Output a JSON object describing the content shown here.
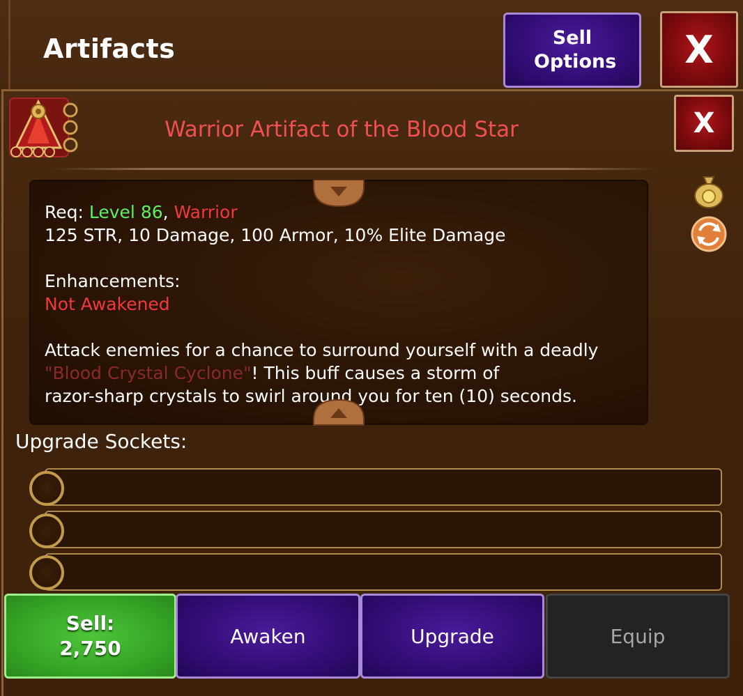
{
  "header": {
    "title": "Artifacts",
    "sell_options_label": "Sell Options",
    "close_label": "X"
  },
  "item": {
    "name": "Warrior Artifact of the Blood Star",
    "name_color": "#f05050",
    "close_label": "X",
    "icon": "blood-star-artifact-icon"
  },
  "side_icons": {
    "gold_bag": "gold-bag-icon",
    "swap": "swap-icon"
  },
  "description": {
    "req_label": "Req: ",
    "req_level": "Level 86",
    "req_sep": ", ",
    "req_class": "Warrior",
    "stats": "125 STR, 10 Damage, 100 Armor, 10% Elite Damage",
    "enhancements_label": "Enhancements:",
    "enhancements_value": "Not Awakened",
    "ability_line1": "Attack enemies for a chance to surround yourself with a deadly",
    "ability_name": "\"Blood Crystal Cyclone\"",
    "ability_line2_rest": "! This buff causes a storm of",
    "ability_line3": "razor-sharp crystals to swirl around you for ten (10) seconds."
  },
  "sockets": {
    "label": "Upgrade Sockets:",
    "count": 3
  },
  "buttons": {
    "sell_label": "Sell:",
    "sell_price": "2,750",
    "awaken": "Awaken",
    "upgrade": "Upgrade",
    "equip": "Equip"
  },
  "colors": {
    "level_green": "#5ef05e",
    "class_red": "#f03a3a",
    "sell_green": "#35a626",
    "action_purple": "#2e0b6e",
    "close_red": "#7a0a0d"
  }
}
